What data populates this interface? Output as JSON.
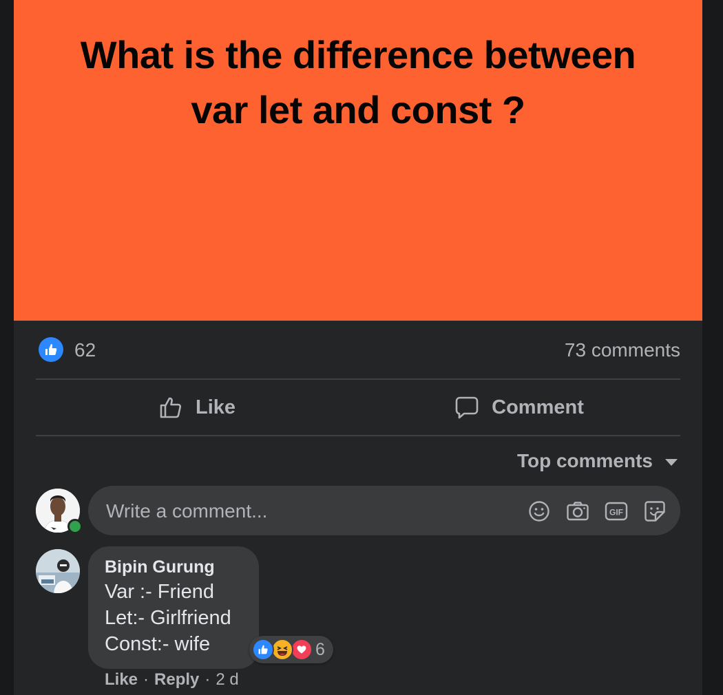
{
  "post": {
    "image_text_line1": "What is the difference between",
    "image_text_line2": "var let and const ?"
  },
  "stats": {
    "like_count": "62",
    "comments_count": "73 comments"
  },
  "actions": {
    "like_label": "Like",
    "comment_label": "Comment"
  },
  "sort": {
    "label": "Top comments"
  },
  "composer": {
    "placeholder": "Write a comment..."
  },
  "comment": {
    "author": "Bipin Gurung",
    "lines": [
      "Var :- Friend",
      "Let:- Girlfriend",
      "Const:- wife"
    ],
    "reaction_count": "6",
    "reactions": [
      "like-reaction-icon",
      "haha-reaction-icon",
      "love-reaction-icon"
    ],
    "like_label": "Like",
    "reply_label": "Reply",
    "separator": "·",
    "time": "2 d"
  },
  "colors": {
    "image_background": "#ff6231",
    "page_background": "#18191a",
    "card_background": "#242526",
    "bubble_background": "#3a3b3c",
    "accent_blue": "#2d88ff",
    "secondary_text": "#b0b3b8",
    "online_green": "#31a24c"
  }
}
